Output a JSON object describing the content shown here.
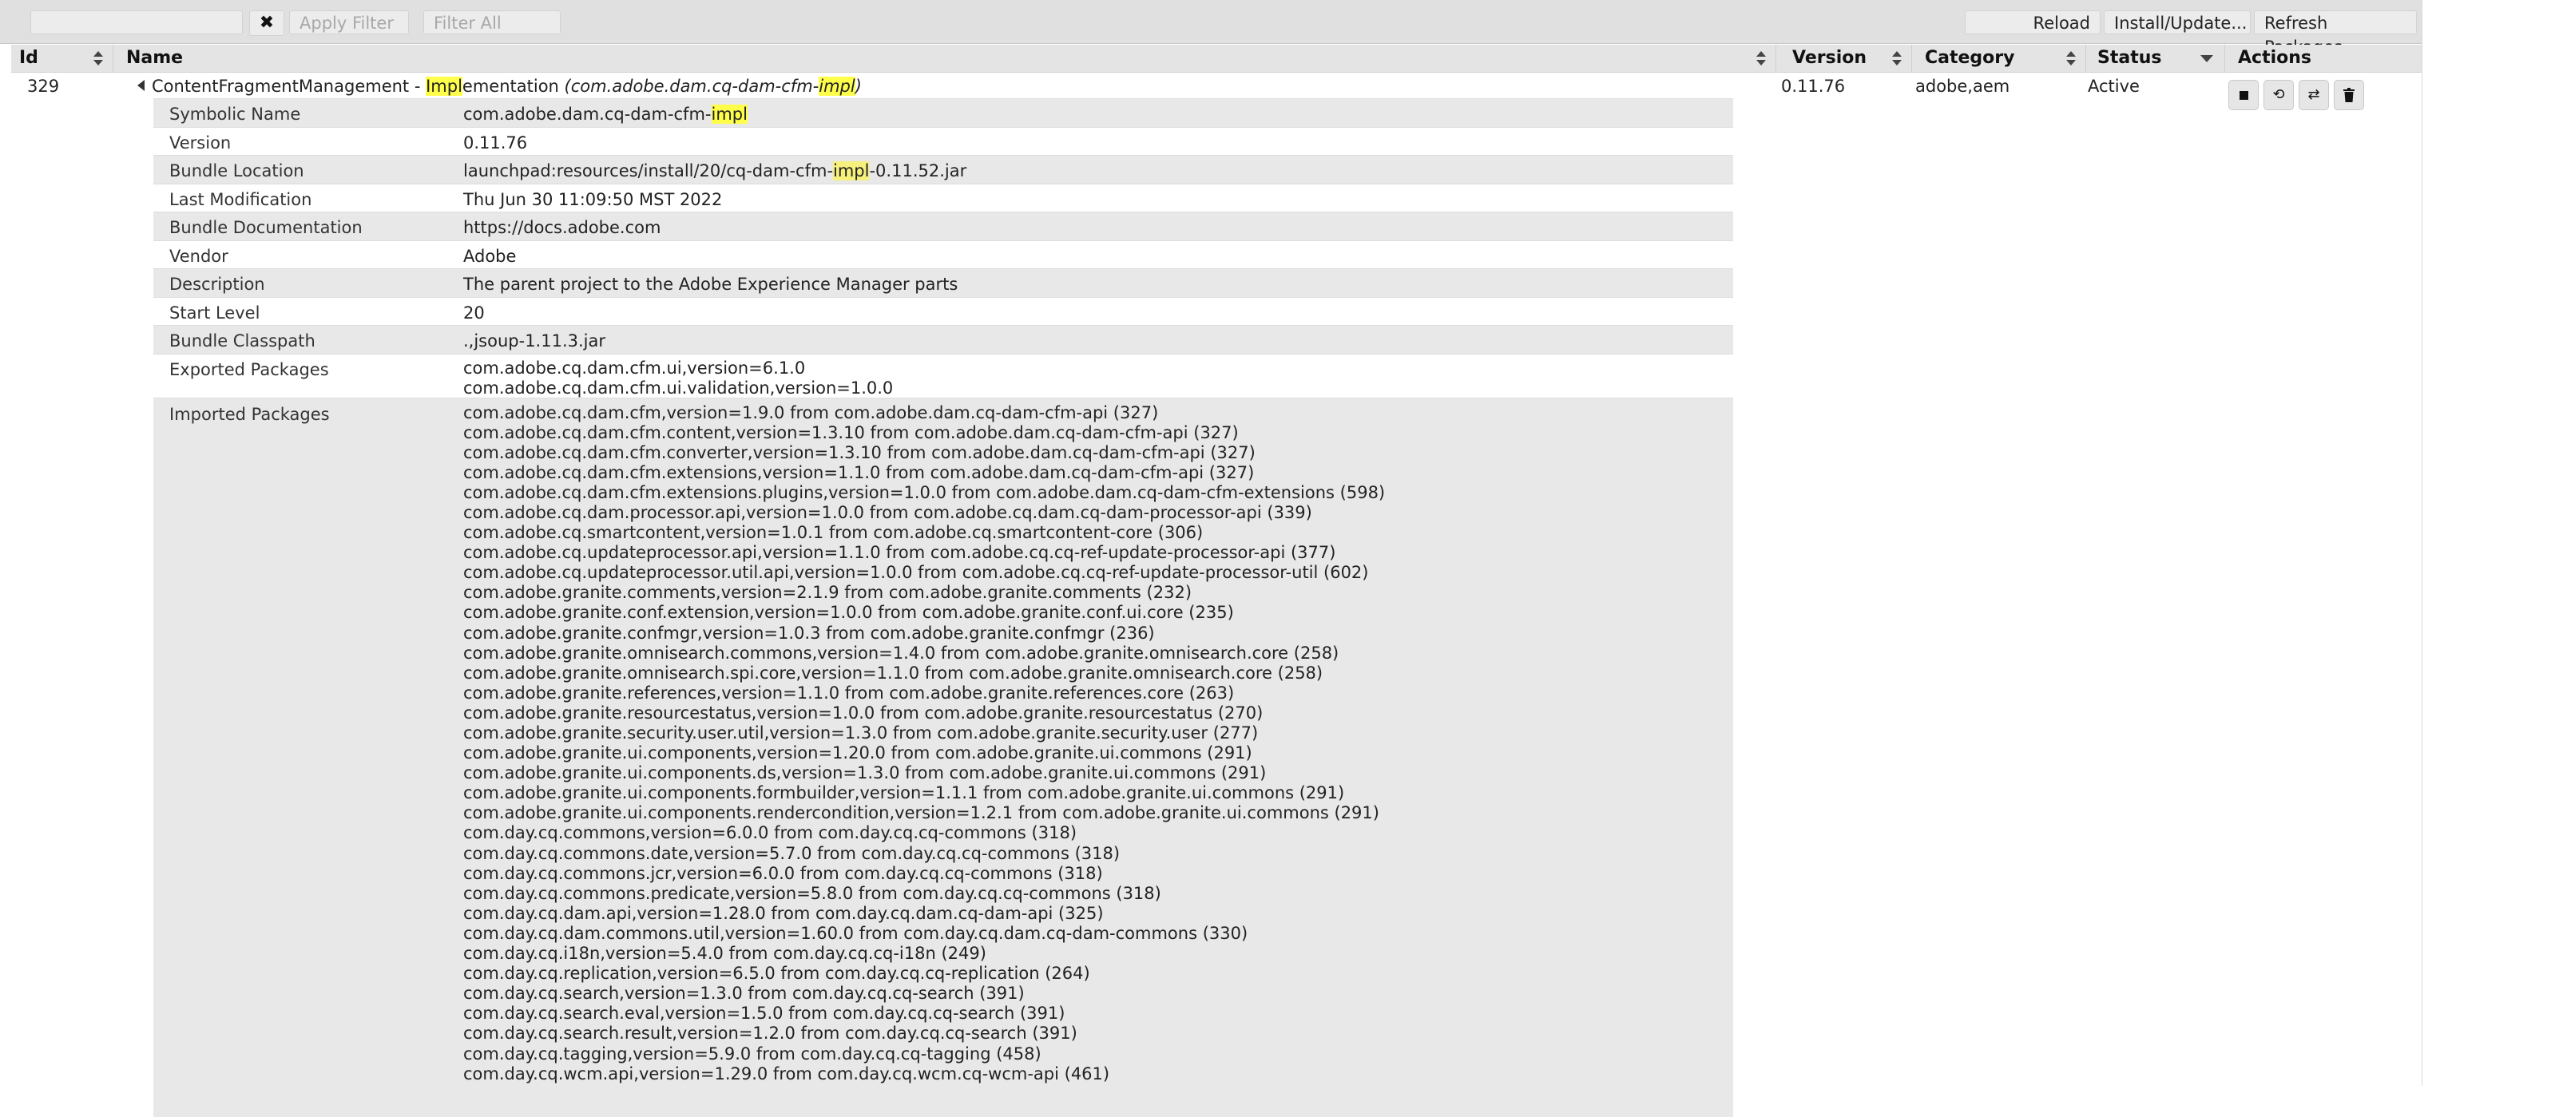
{
  "toolbar": {
    "clear_label": "✖",
    "apply_filter": "Apply Filter",
    "filter_all": "Filter All",
    "reload": "Reload",
    "install_update": "Install/Update...",
    "refresh_packages": "Refresh Packages"
  },
  "columns": [
    "Id",
    "Name",
    "Version",
    "Category",
    "Status",
    "Actions"
  ],
  "bundle": {
    "id": "329",
    "name_pre": "ContentFragmentManagement - ",
    "name_hl": "Impl",
    "name_post": "ementation ",
    "sym_pre": "(com.adobe.dam.cq-dam-cfm-",
    "sym_hl": "impl",
    "sym_post": ")",
    "version": "0.11.76",
    "category": "adobe,aem",
    "status": "Active"
  },
  "details": {
    "symbolic_name": {
      "label": "Symbolic Name",
      "pre": "com.adobe.dam.cq-dam-cfm-",
      "hl": "impl"
    },
    "version": {
      "label": "Version",
      "value": "0.11.76"
    },
    "bundle_location": {
      "label": "Bundle Location",
      "pre": "launchpad:resources/install/20/cq-dam-cfm-",
      "hl": "impl",
      "post": "-0.11.52.jar"
    },
    "last_modification": {
      "label": "Last Modification",
      "value": "Thu Jun 30 11:09:50 MST 2022"
    },
    "bundle_documentation": {
      "label": "Bundle Documentation",
      "value": "https://docs.adobe.com"
    },
    "vendor": {
      "label": "Vendor",
      "value": "Adobe"
    },
    "description": {
      "label": "Description",
      "value": "The parent project to the Adobe Experience Manager parts"
    },
    "start_level": {
      "label": "Start Level",
      "value": "20"
    },
    "bundle_classpath": {
      "label": "Bundle Classpath",
      "value": ".,jsoup-1.11.3.jar"
    },
    "exported_packages": {
      "label": "Exported Packages",
      "items": [
        "com.adobe.cq.dam.cfm.ui,version=6.1.0",
        "com.adobe.cq.dam.cfm.ui.validation,version=1.0.0"
      ]
    },
    "imported_packages": {
      "label": "Imported Packages",
      "items": [
        "com.adobe.cq.dam.cfm,version=1.9.0 from com.adobe.dam.cq-dam-cfm-api (327)",
        "com.adobe.cq.dam.cfm.content,version=1.3.10 from com.adobe.dam.cq-dam-cfm-api (327)",
        "com.adobe.cq.dam.cfm.converter,version=1.3.10 from com.adobe.dam.cq-dam-cfm-api (327)",
        "com.adobe.cq.dam.cfm.extensions,version=1.1.0 from com.adobe.dam.cq-dam-cfm-api (327)",
        "com.adobe.cq.dam.cfm.extensions.plugins,version=1.0.0 from com.adobe.dam.cq-dam-cfm-extensions (598)",
        "com.adobe.cq.dam.processor.api,version=1.0.0 from com.adobe.cq.dam.cq-dam-processor-api (339)",
        "com.adobe.cq.smartcontent,version=1.0.1 from com.adobe.cq.smartcontent-core (306)",
        "com.adobe.cq.updateprocessor.api,version=1.1.0 from com.adobe.cq.cq-ref-update-processor-api (377)",
        "com.adobe.cq.updateprocessor.util.api,version=1.0.0 from com.adobe.cq.cq-ref-update-processor-util (602)",
        "com.adobe.granite.comments,version=2.1.9 from com.adobe.granite.comments (232)",
        "com.adobe.granite.conf.extension,version=1.0.0 from com.adobe.granite.conf.ui.core (235)",
        "com.adobe.granite.confmgr,version=1.0.3 from com.adobe.granite.confmgr (236)",
        "com.adobe.granite.omnisearch.commons,version=1.4.0 from com.adobe.granite.omnisearch.core (258)",
        "com.adobe.granite.omnisearch.spi.core,version=1.1.0 from com.adobe.granite.omnisearch.core (258)",
        "com.adobe.granite.references,version=1.1.0 from com.adobe.granite.references.core (263)",
        "com.adobe.granite.resourcestatus,version=1.0.0 from com.adobe.granite.resourcestatus (270)",
        "com.adobe.granite.security.user.util,version=1.3.0 from com.adobe.granite.security.user (277)",
        "com.adobe.granite.ui.components,version=1.20.0 from com.adobe.granite.ui.commons (291)",
        "com.adobe.granite.ui.components.ds,version=1.3.0 from com.adobe.granite.ui.commons (291)",
        "com.adobe.granite.ui.components.formbuilder,version=1.1.1 from com.adobe.granite.ui.commons (291)",
        "com.adobe.granite.ui.components.rendercondition,version=1.2.1 from com.adobe.granite.ui.commons (291)",
        "com.day.cq.commons,version=6.0.0 from com.day.cq.cq-commons (318)",
        "com.day.cq.commons.date,version=5.7.0 from com.day.cq.cq-commons (318)",
        "com.day.cq.commons.jcr,version=6.0.0 from com.day.cq.cq-commons (318)",
        "com.day.cq.commons.predicate,version=5.8.0 from com.day.cq.cq-commons (318)",
        "com.day.cq.dam.api,version=1.28.0 from com.day.cq.dam.cq-dam-api (325)",
        "com.day.cq.dam.commons.util,version=1.60.0 from com.day.cq.dam.cq-dam-commons (330)",
        "com.day.cq.i18n,version=5.4.0 from com.day.cq.cq-i18n (249)",
        "com.day.cq.replication,version=6.5.0 from com.day.cq.cq-replication (264)",
        "com.day.cq.search,version=1.3.0 from com.day.cq.cq-search (391)",
        "com.day.cq.search.eval,version=1.5.0 from com.day.cq.cq-search (391)",
        "com.day.cq.search.result,version=1.2.0 from com.day.cq.cq-search (391)",
        "com.day.cq.tagging,version=5.9.0 from com.day.cq.cq-tagging (458)",
        "com.day.cq.wcm.api,version=1.29.0 from com.day.cq.wcm.cq-wcm-api (461)"
      ]
    }
  }
}
